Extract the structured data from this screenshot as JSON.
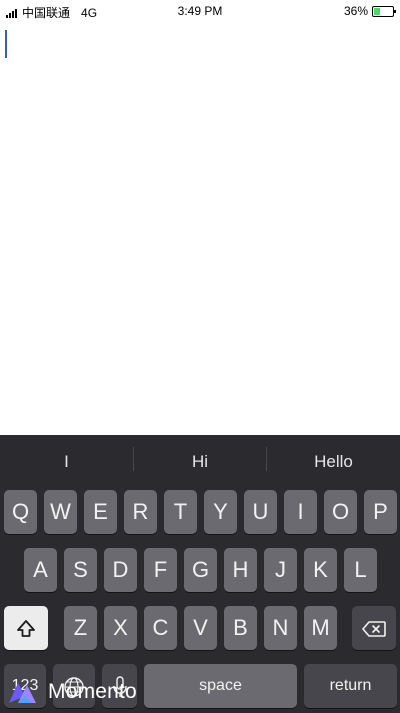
{
  "status_bar": {
    "carrier": "中国联通",
    "network": "4G",
    "time": "3:49 PM",
    "battery_percent": "36%",
    "battery_level": 0.36,
    "battery_color": "#4cd964"
  },
  "keyboard": {
    "suggestions": [
      "I",
      "Hi",
      "Hello"
    ],
    "row1": [
      "Q",
      "W",
      "E",
      "R",
      "T",
      "Y",
      "U",
      "I",
      "O",
      "P"
    ],
    "row2": [
      "A",
      "S",
      "D",
      "F",
      "G",
      "H",
      "J",
      "K",
      "L"
    ],
    "row3": [
      "Z",
      "X",
      "C",
      "V",
      "B",
      "N",
      "M"
    ],
    "numbers_key": "123",
    "space_key": "space",
    "return_key": "return",
    "shift_icon": "shift-icon",
    "backspace_icon": "backspace-icon",
    "globe_icon": "globe-icon",
    "mic_icon": "microphone-icon"
  },
  "watermark": {
    "text": "Momento",
    "icon": "momento-logo-icon"
  }
}
